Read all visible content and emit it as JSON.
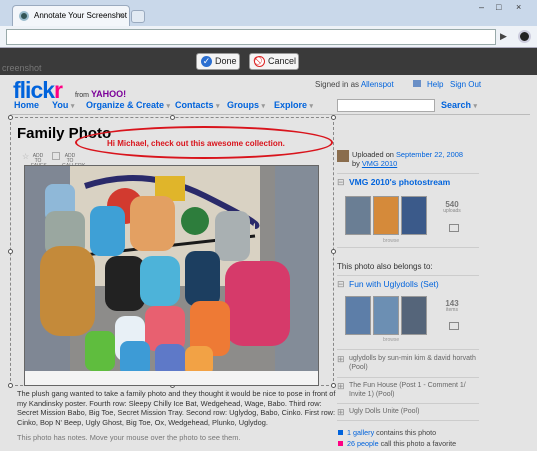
{
  "browser": {
    "tab_title": "Annotate Your Screenshot",
    "tab_close": "×",
    "window_controls": [
      "–",
      "□",
      "×"
    ],
    "go_icon": "▶"
  },
  "annotation_toolbar": {
    "label": "creenshot",
    "done_label": "Done",
    "cancel_label": "Cancel"
  },
  "flickr": {
    "logo_a": "flick",
    "logo_b": "r",
    "from_label": "from",
    "yahoo_label": "YAHOO!",
    "signed_in_prefix": "Signed in as",
    "username": "Allenspot",
    "help_label": "Help",
    "signout_label": "Sign Out",
    "nav": [
      "Home",
      "You",
      "Organize & Create",
      "Contacts",
      "Groups",
      "Explore"
    ],
    "search_label": "Search"
  },
  "photo": {
    "title": "Family Photo",
    "add_faves": "ADD TO FAVES",
    "add_gallery": "ADD TO GALLERY",
    "annotation_text": "Hi Michael, check out this awesome collection.",
    "description": "The plush gang wanted to take a family photo and they thought it would be nice to pose in front of my Kandinsky poster. Fourth row: Sleepy Chilly Ice Bat, Wedgehead, Wage, Babo. Third row: Secret Mission Babo, Big Toe, Secret Mission Tray. Second row: Uglydog, Babo, Cinko. First row: Cinko, Bop N' Beep, Ugly Ghost, Big Toe, Ox, Wedgehead, Plunko, Uglydog.",
    "notes_hint": "This photo has notes. Move your mouse over the photo to see them."
  },
  "sidebar": {
    "uploaded_prefix": "Uploaded on",
    "uploaded_date": "September 22, 2008",
    "by_prefix": "by",
    "uploader": "VMG 2010",
    "stream_title": "VMG 2010's photostream",
    "stream_count": "540",
    "stream_count_label": "uploads",
    "browse_label": "browse",
    "also_belongs": "This photo also belongs to:",
    "set_title": "Fun with Uglydolls (Set)",
    "set_count": "143",
    "set_count_label": "items",
    "pools": [
      "uglydolls by sun-min kim & david horvath (Pool)",
      "The Fun House (Post 1 - Comment 1/ Invite 1) (Pool)",
      "Ugly Dolls Unite (Pool)"
    ],
    "gallery_count": "1 gallery",
    "gallery_suffix": "contains this photo",
    "fav_count": "26 people",
    "fav_suffix": "call this photo a favorite"
  },
  "colors": {
    "flickr_blue": "#0063dc",
    "flickr_pink": "#ff0084",
    "annotation_red": "#d9141c",
    "toolbar_dark": "#3a3a3a"
  },
  "icons": {
    "done": "check-icon",
    "cancel": "no-entry-icon",
    "expand": "plus-icon",
    "nav_dropdown": "chevron-down-icon"
  }
}
